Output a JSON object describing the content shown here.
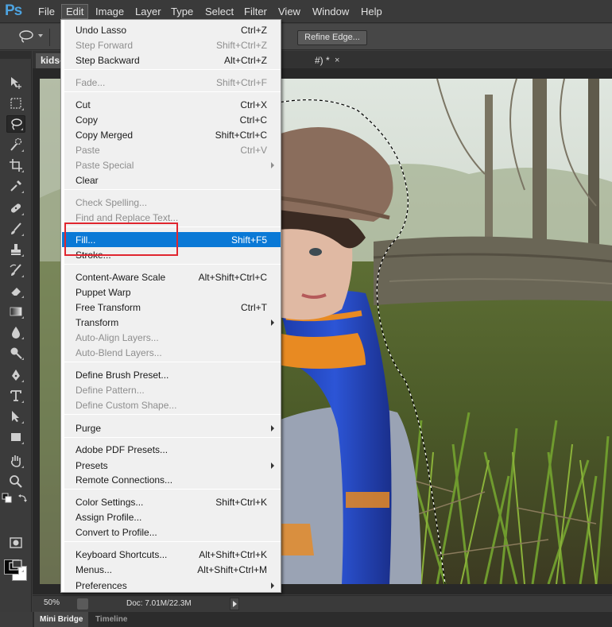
{
  "app": {
    "logo_text": "Ps"
  },
  "menubar": {
    "items": [
      {
        "label": "File"
      },
      {
        "label": "Edit",
        "active": true
      },
      {
        "label": "Image"
      },
      {
        "label": "Layer"
      },
      {
        "label": "Type"
      },
      {
        "label": "Select"
      },
      {
        "label": "Filter"
      },
      {
        "label": "View"
      },
      {
        "label": "Window"
      },
      {
        "label": "Help"
      }
    ]
  },
  "options_bar": {
    "refine_edge_label": "Refine Edge..."
  },
  "document": {
    "tab_label": "kids-",
    "tab_suffix": "#) *",
    "close_glyph": "×"
  },
  "status_bar": {
    "zoom": "50%",
    "doc_size": "Doc: 7.01M/22.3M"
  },
  "bottom_panel": {
    "tabs": [
      {
        "label": "Mini Bridge",
        "active": true
      },
      {
        "label": "Timeline",
        "active": false
      }
    ]
  },
  "colors": {
    "foreground": "#050505",
    "background": "#ffffff",
    "highlight": "#0a79d6",
    "callout": "#e0262f"
  },
  "tools": [
    "move-icon",
    "marquee-icon",
    "lasso-icon",
    "quick-select-icon",
    "crop-icon",
    "eyedropper-icon",
    "healing-brush-icon",
    "brush-icon",
    "clone-stamp-icon",
    "history-brush-icon",
    "eraser-icon",
    "gradient-icon",
    "blur-icon",
    "dodge-icon",
    "pen-icon",
    "type-icon",
    "path-select-icon",
    "shape-icon",
    "hand-icon",
    "zoom-icon",
    "quick-mask-icon",
    "screen-mode-icon"
  ],
  "edit_menu": {
    "items": [
      {
        "label": "Undo Lasso",
        "shortcut": "Ctrl+Z",
        "disabled": false
      },
      {
        "label": "Step Forward",
        "shortcut": "Shift+Ctrl+Z",
        "disabled": true
      },
      {
        "label": "Step Backward",
        "shortcut": "Alt+Ctrl+Z",
        "disabled": false
      },
      {
        "label": "Fade...",
        "shortcut": "Shift+Ctrl+F",
        "disabled": true
      },
      {
        "label": "Cut",
        "shortcut": "Ctrl+X",
        "disabled": false
      },
      {
        "label": "Copy",
        "shortcut": "Ctrl+C",
        "disabled": false
      },
      {
        "label": "Copy Merged",
        "shortcut": "Shift+Ctrl+C",
        "disabled": false
      },
      {
        "label": "Paste",
        "shortcut": "Ctrl+V",
        "disabled": true
      },
      {
        "label": "Paste Special",
        "shortcut": "",
        "disabled": true,
        "submenu": true
      },
      {
        "label": "Clear",
        "shortcut": "",
        "disabled": false
      },
      {
        "label": "Check Spelling...",
        "shortcut": "",
        "disabled": true
      },
      {
        "label": "Find and Replace Text...",
        "shortcut": "",
        "disabled": true
      },
      {
        "label": "Fill...",
        "shortcut": "Shift+F5",
        "disabled": false,
        "highlighted": true
      },
      {
        "label": "Stroke...",
        "shortcut": "",
        "disabled": false
      },
      {
        "label": "Content-Aware Scale",
        "shortcut": "Alt+Shift+Ctrl+C",
        "disabled": false
      },
      {
        "label": "Puppet Warp",
        "shortcut": "",
        "disabled": false
      },
      {
        "label": "Free Transform",
        "shortcut": "Ctrl+T",
        "disabled": false
      },
      {
        "label": "Transform",
        "shortcut": "",
        "disabled": false,
        "submenu": true
      },
      {
        "label": "Auto-Align Layers...",
        "shortcut": "",
        "disabled": true
      },
      {
        "label": "Auto-Blend Layers...",
        "shortcut": "",
        "disabled": true
      },
      {
        "label": "Define Brush Preset...",
        "shortcut": "",
        "disabled": false
      },
      {
        "label": "Define Pattern...",
        "shortcut": "",
        "disabled": true
      },
      {
        "label": "Define Custom Shape...",
        "shortcut": "",
        "disabled": true
      },
      {
        "label": "Purge",
        "shortcut": "",
        "disabled": false,
        "submenu": true
      },
      {
        "label": "Adobe PDF Presets...",
        "shortcut": "",
        "disabled": false
      },
      {
        "label": "Presets",
        "shortcut": "",
        "disabled": false,
        "submenu": true
      },
      {
        "label": "Remote Connections...",
        "shortcut": "",
        "disabled": false
      },
      {
        "label": "Color Settings...",
        "shortcut": "Shift+Ctrl+K",
        "disabled": false
      },
      {
        "label": "Assign Profile...",
        "shortcut": "",
        "disabled": false
      },
      {
        "label": "Convert to Profile...",
        "shortcut": "",
        "disabled": false
      },
      {
        "label": "Keyboard Shortcuts...",
        "shortcut": "Alt+Shift+Ctrl+K",
        "disabled": false
      },
      {
        "label": "Menus...",
        "shortcut": "Alt+Shift+Ctrl+M",
        "disabled": false
      },
      {
        "label": "Preferences",
        "shortcut": "",
        "disabled": false,
        "submenu": true
      }
    ]
  }
}
